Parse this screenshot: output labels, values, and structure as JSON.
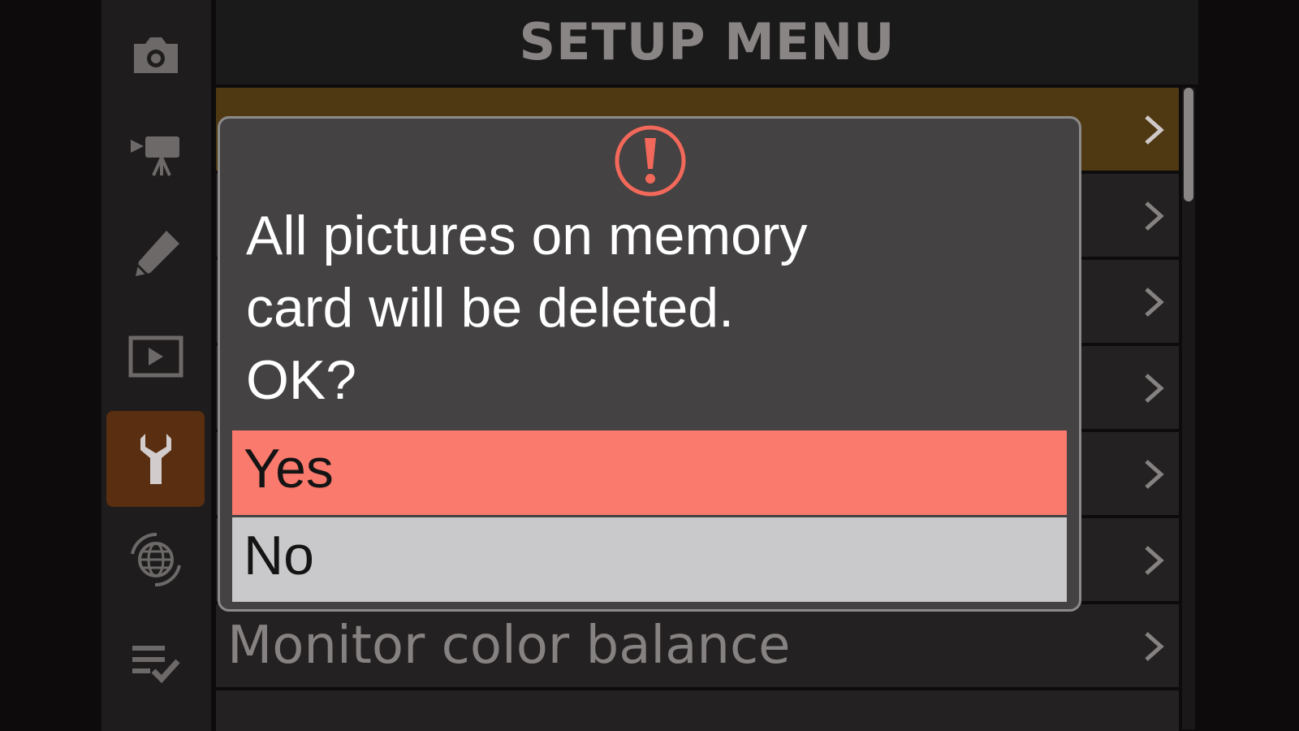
{
  "header": {
    "title": "SETUP MENU"
  },
  "sidebar": {
    "items": [
      {
        "icon": "photo-shooting-icon",
        "active": false
      },
      {
        "icon": "movie-recording-icon",
        "active": false
      },
      {
        "icon": "custom-settings-pencil-icon",
        "active": false
      },
      {
        "icon": "playback-icon",
        "active": false
      },
      {
        "icon": "setup-wrench-icon",
        "active": true
      },
      {
        "icon": "network-globe-icon",
        "active": false
      },
      {
        "icon": "my-menu-icon",
        "active": false
      }
    ]
  },
  "menu": {
    "items": [
      {
        "label": "",
        "value": "",
        "selected": true
      },
      {
        "label": "",
        "value": "",
        "selected": false
      },
      {
        "label": "",
        "value": "",
        "selected": false
      },
      {
        "label": "",
        "value": "",
        "selected": false
      },
      {
        "label": "",
        "value": "",
        "selected": false
      },
      {
        "label": "",
        "value": "",
        "selected": false
      },
      {
        "label": "Monitor color balance",
        "value": "",
        "selected": false
      },
      {
        "label": "",
        "value": "",
        "selected": false
      }
    ]
  },
  "dialog": {
    "message_lines": [
      "All pictures on memory",
      "card will be deleted.",
      "OK?"
    ],
    "options": [
      {
        "label": "Yes",
        "highlighted": true
      },
      {
        "label": "No",
        "highlighted": false
      }
    ]
  },
  "colors": {
    "highlight": "#fb7a6e",
    "selected_row": "#4e3913",
    "active_tab": "#5a2e10",
    "alert": "#f2685a"
  }
}
